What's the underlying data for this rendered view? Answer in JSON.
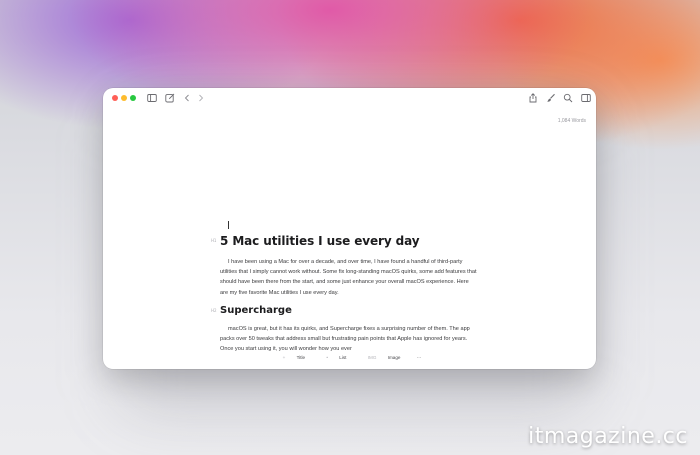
{
  "document": {
    "word_count": "1,084 Words",
    "title": "5 Mac utilities I use every day",
    "title_marker": "H1",
    "intro": "I have been using a Mac for over a decade, and over time, I have found a handful of third-party utilities that I simply cannot work without. Some fix long-standing macOS quirks, some add features that should have been there from the start, and some just enhance your overall macOS experience. Here are my five favorite Mac utilities I use every day.",
    "section_heading": "Supercharge",
    "section_marker": "H2",
    "section_body": "macOS is great, but it has its quirks, and Supercharge fixes a surprising number of them. The app packs over 50 tweaks that address small but frustrating pain points that Apple has ignored for years. Once you start using it, you will wonder how you ever"
  },
  "format_bar": {
    "title_prefix": "+",
    "title_label": "Title",
    "list_prefix": "•",
    "list_label": "List",
    "image_prefix": "IMG",
    "image_label": "Image",
    "more_label": "⋯"
  },
  "toolbar_icons": [
    "sidebar-icon",
    "compose-icon",
    "back-icon",
    "forward-icon",
    "share-icon",
    "brush-icon",
    "search-icon",
    "panel-icon"
  ],
  "watermark": "itmagazine.cc"
}
